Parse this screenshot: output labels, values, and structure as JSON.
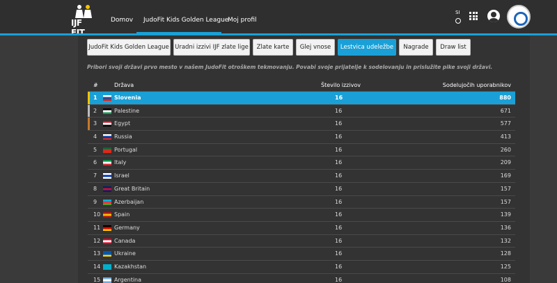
{
  "nav": {
    "logo_text": "IJF FIT",
    "links": [
      "Domov",
      "JudoFit Kids Golden League",
      "Moj profil"
    ],
    "lang": "SI"
  },
  "tabs": [
    "JudoFit Kids Golden League",
    "Uradni izzivi IJF zlate lige",
    "Zlate karte",
    "Glej vnose",
    "Lestvica udeležbe",
    "Nagrade",
    "Draw list"
  ],
  "active_tab": "Lestvica udeležbe",
  "intro": "Pribori svoji državi prvo mesto v našem JudoFit otroškem tekmovanju. Povabi svoje prijatelje k sodelovanju in prislužite pike svoji državi.",
  "table": {
    "headers": {
      "num": "#",
      "country": "Država",
      "challenges": "Število izzivov",
      "users": "Sodelujočih uporabnikov"
    },
    "rows": [
      {
        "num": "1",
        "country": "Slovenia",
        "challenges": "16",
        "users": "880",
        "flag": [
          "#ffffff",
          "#1c4fa0",
          "#e2231a"
        ]
      },
      {
        "num": "2",
        "country": "Palestine",
        "challenges": "16",
        "users": "671",
        "flag": [
          "#000000",
          "#ffffff",
          "#149954"
        ]
      },
      {
        "num": "3",
        "country": "Egypt",
        "challenges": "16",
        "users": "577",
        "flag": [
          "#ce1126",
          "#ffffff",
          "#000000"
        ]
      },
      {
        "num": "4",
        "country": "Russia",
        "challenges": "16",
        "users": "413",
        "flag": [
          "#ffffff",
          "#0039a6",
          "#d52b1e"
        ]
      },
      {
        "num": "5",
        "country": "Portugal",
        "challenges": "16",
        "users": "260",
        "flag": [
          "#046a38",
          "#da291c",
          "#da291c"
        ]
      },
      {
        "num": "6",
        "country": "Italy",
        "challenges": "16",
        "users": "209",
        "flag": [
          "#009246",
          "#ffffff",
          "#ce2b37"
        ]
      },
      {
        "num": "7",
        "country": "Israel",
        "challenges": "16",
        "users": "169",
        "flag": [
          "#ffffff",
          "#0038b8",
          "#ffffff"
        ]
      },
      {
        "num": "8",
        "country": "Great Britain",
        "challenges": "16",
        "users": "157",
        "flag": [
          "#012169",
          "#c8102e",
          "#012169"
        ]
      },
      {
        "num": "9",
        "country": "Azerbaijan",
        "challenges": "16",
        "users": "157",
        "flag": [
          "#00b5e2",
          "#ef3340",
          "#509e2f"
        ]
      },
      {
        "num": "10",
        "country": "Spain",
        "challenges": "16",
        "users": "139",
        "flag": [
          "#aa151b",
          "#f1bf00",
          "#aa151b"
        ]
      },
      {
        "num": "11",
        "country": "Germany",
        "challenges": "16",
        "users": "136",
        "flag": [
          "#000000",
          "#dd0000",
          "#ffce00"
        ]
      },
      {
        "num": "12",
        "country": "Canada",
        "challenges": "16",
        "users": "132",
        "flag": [
          "#d80621",
          "#ffffff",
          "#d80621"
        ]
      },
      {
        "num": "13",
        "country": "Ukraine",
        "challenges": "16",
        "users": "128",
        "flag": [
          "#0057b7",
          "#0057b7",
          "#ffd700"
        ]
      },
      {
        "num": "14",
        "country": "Kazakhstan",
        "challenges": "16",
        "users": "125",
        "flag": [
          "#00afca",
          "#00afca",
          "#00afca"
        ]
      },
      {
        "num": "15",
        "country": "Argentina",
        "challenges": "16",
        "users": "108",
        "flag": [
          "#74acdf",
          "#ffffff",
          "#74acdf"
        ]
      }
    ],
    "podium_colors": [
      "#f5c400",
      "#bdbdbd",
      "#c57a2c"
    ]
  }
}
